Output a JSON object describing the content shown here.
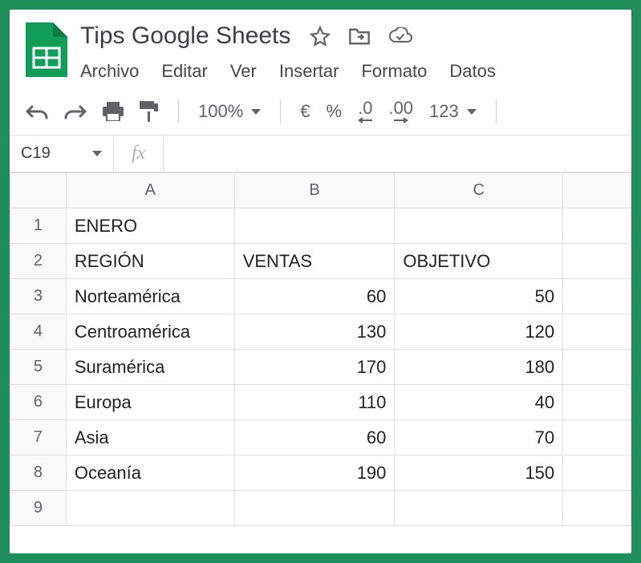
{
  "doc": {
    "title": "Tips Google Sheets"
  },
  "menu": {
    "archivo": "Archivo",
    "editar": "Editar",
    "ver": "Ver",
    "insertar": "Insertar",
    "formato": "Formato",
    "datos": "Datos"
  },
  "toolbar": {
    "zoom": "100%",
    "currency": "€",
    "percent": "%",
    "dec_dec": ".0",
    "inc_dec": ".00",
    "numfmt": "123"
  },
  "namebox": {
    "ref": "C19"
  },
  "fx": {
    "label": "fx",
    "value": ""
  },
  "columns": [
    "A",
    "B",
    "C"
  ],
  "rows": [
    "1",
    "2",
    "3",
    "4",
    "5",
    "6",
    "7",
    "8",
    "9"
  ],
  "chart_data": {
    "type": "table",
    "title": "ENERO",
    "columns": [
      "REGIÓN",
      "VENTAS",
      "OBJETIVO"
    ],
    "rows": [
      {
        "region": "Norteamérica",
        "ventas": 60,
        "objetivo": 50
      },
      {
        "region": "Centroamérica",
        "ventas": 130,
        "objetivo": 120
      },
      {
        "region": "Suramérica",
        "ventas": 170,
        "objetivo": 180
      },
      {
        "region": "Europa",
        "ventas": 110,
        "objetivo": 40
      },
      {
        "region": "Asia",
        "ventas": 60,
        "objetivo": 70
      },
      {
        "region": "Oceanía",
        "ventas": 190,
        "objetivo": 150
      }
    ]
  }
}
